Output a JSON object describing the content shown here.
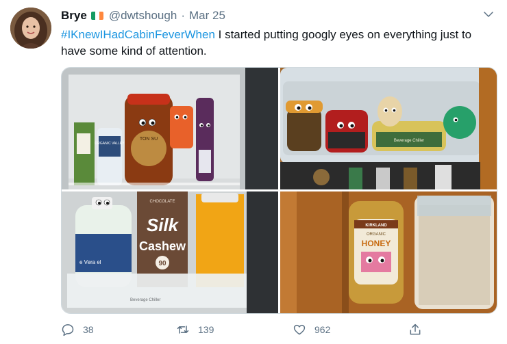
{
  "tweet": {
    "display_name": "Brye",
    "handle": "@dwtshough",
    "separator": "·",
    "date": "Mar 25",
    "hashtag": "#IKnewIHadCabinFeverWhen",
    "text": " I started putting googly eyes on everything just to have some kind of attention."
  },
  "flag_colors": [
    "#169b62",
    "#ffffff",
    "#ff883e"
  ],
  "icons": {
    "more": "chevron-down-icon",
    "reply": "reply-icon",
    "retweet": "retweet-icon",
    "like": "heart-icon",
    "share": "share-icon"
  },
  "photos": [
    {
      "labels": {
        "jar_label": "TON SU",
        "bottle_label": "ORGANIC VALLEY"
      }
    },
    {
      "labels": {
        "container_label": "Beverage Chiller"
      }
    },
    {
      "labels": {
        "carton_top": "CHOCOLATE",
        "brand": "Silk",
        "carton_name": "Cashew",
        "badge": "90",
        "side_text": "e Vera\nel",
        "chiller_label": "Beverage Chiller"
      }
    },
    {
      "labels": {
        "brand": "KIRKLAND",
        "organic": "ORGANIC",
        "product": "HONEY"
      }
    }
  ],
  "metrics": {
    "replies": "38",
    "retweets": "139",
    "likes": "962"
  },
  "colors": {
    "accent": "#1b95e0",
    "muted": "#5b7083"
  }
}
